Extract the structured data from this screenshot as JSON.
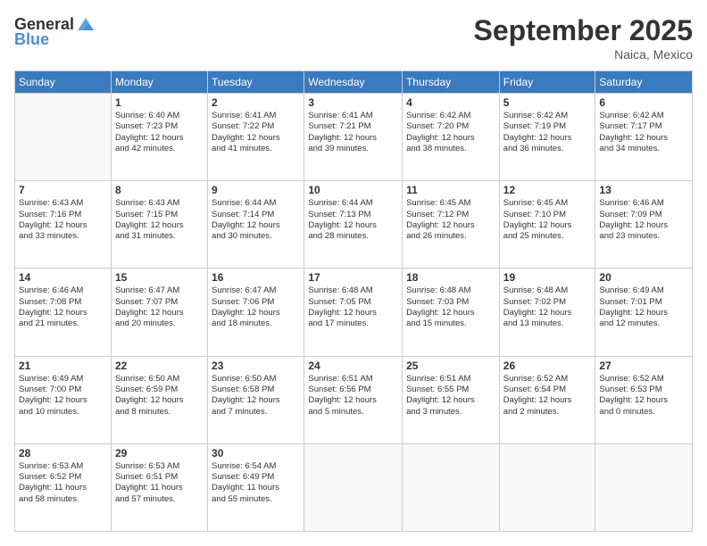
{
  "header": {
    "logo_general": "General",
    "logo_blue": "Blue",
    "month_title": "September 2025",
    "location": "Naica, Mexico"
  },
  "days_of_week": [
    "Sunday",
    "Monday",
    "Tuesday",
    "Wednesday",
    "Thursday",
    "Friday",
    "Saturday"
  ],
  "weeks": [
    [
      {
        "day": "",
        "info": ""
      },
      {
        "day": "1",
        "info": "Sunrise: 6:40 AM\nSunset: 7:23 PM\nDaylight: 12 hours\nand 42 minutes."
      },
      {
        "day": "2",
        "info": "Sunrise: 6:41 AM\nSunset: 7:22 PM\nDaylight: 12 hours\nand 41 minutes."
      },
      {
        "day": "3",
        "info": "Sunrise: 6:41 AM\nSunset: 7:21 PM\nDaylight: 12 hours\nand 39 minutes."
      },
      {
        "day": "4",
        "info": "Sunrise: 6:42 AM\nSunset: 7:20 PM\nDaylight: 12 hours\nand 38 minutes."
      },
      {
        "day": "5",
        "info": "Sunrise: 6:42 AM\nSunset: 7:19 PM\nDaylight: 12 hours\nand 36 minutes."
      },
      {
        "day": "6",
        "info": "Sunrise: 6:42 AM\nSunset: 7:17 PM\nDaylight: 12 hours\nand 34 minutes."
      }
    ],
    [
      {
        "day": "7",
        "info": "Sunrise: 6:43 AM\nSunset: 7:16 PM\nDaylight: 12 hours\nand 33 minutes."
      },
      {
        "day": "8",
        "info": "Sunrise: 6:43 AM\nSunset: 7:15 PM\nDaylight: 12 hours\nand 31 minutes."
      },
      {
        "day": "9",
        "info": "Sunrise: 6:44 AM\nSunset: 7:14 PM\nDaylight: 12 hours\nand 30 minutes."
      },
      {
        "day": "10",
        "info": "Sunrise: 6:44 AM\nSunset: 7:13 PM\nDaylight: 12 hours\nand 28 minutes."
      },
      {
        "day": "11",
        "info": "Sunrise: 6:45 AM\nSunset: 7:12 PM\nDaylight: 12 hours\nand 26 minutes."
      },
      {
        "day": "12",
        "info": "Sunrise: 6:45 AM\nSunset: 7:10 PM\nDaylight: 12 hours\nand 25 minutes."
      },
      {
        "day": "13",
        "info": "Sunrise: 6:46 AM\nSunset: 7:09 PM\nDaylight: 12 hours\nand 23 minutes."
      }
    ],
    [
      {
        "day": "14",
        "info": "Sunrise: 6:46 AM\nSunset: 7:08 PM\nDaylight: 12 hours\nand 21 minutes."
      },
      {
        "day": "15",
        "info": "Sunrise: 6:47 AM\nSunset: 7:07 PM\nDaylight: 12 hours\nand 20 minutes."
      },
      {
        "day": "16",
        "info": "Sunrise: 6:47 AM\nSunset: 7:06 PM\nDaylight: 12 hours\nand 18 minutes."
      },
      {
        "day": "17",
        "info": "Sunrise: 6:48 AM\nSunset: 7:05 PM\nDaylight: 12 hours\nand 17 minutes."
      },
      {
        "day": "18",
        "info": "Sunrise: 6:48 AM\nSunset: 7:03 PM\nDaylight: 12 hours\nand 15 minutes."
      },
      {
        "day": "19",
        "info": "Sunrise: 6:48 AM\nSunset: 7:02 PM\nDaylight: 12 hours\nand 13 minutes."
      },
      {
        "day": "20",
        "info": "Sunrise: 6:49 AM\nSunset: 7:01 PM\nDaylight: 12 hours\nand 12 minutes."
      }
    ],
    [
      {
        "day": "21",
        "info": "Sunrise: 6:49 AM\nSunset: 7:00 PM\nDaylight: 12 hours\nand 10 minutes."
      },
      {
        "day": "22",
        "info": "Sunrise: 6:50 AM\nSunset: 6:59 PM\nDaylight: 12 hours\nand 8 minutes."
      },
      {
        "day": "23",
        "info": "Sunrise: 6:50 AM\nSunset: 6:58 PM\nDaylight: 12 hours\nand 7 minutes."
      },
      {
        "day": "24",
        "info": "Sunrise: 6:51 AM\nSunset: 6:56 PM\nDaylight: 12 hours\nand 5 minutes."
      },
      {
        "day": "25",
        "info": "Sunrise: 6:51 AM\nSunset: 6:55 PM\nDaylight: 12 hours\nand 3 minutes."
      },
      {
        "day": "26",
        "info": "Sunrise: 6:52 AM\nSunset: 6:54 PM\nDaylight: 12 hours\nand 2 minutes."
      },
      {
        "day": "27",
        "info": "Sunrise: 6:52 AM\nSunset: 6:53 PM\nDaylight: 12 hours\nand 0 minutes."
      }
    ],
    [
      {
        "day": "28",
        "info": "Sunrise: 6:53 AM\nSunset: 6:52 PM\nDaylight: 11 hours\nand 58 minutes."
      },
      {
        "day": "29",
        "info": "Sunrise: 6:53 AM\nSunset: 6:51 PM\nDaylight: 11 hours\nand 57 minutes."
      },
      {
        "day": "30",
        "info": "Sunrise: 6:54 AM\nSunset: 6:49 PM\nDaylight: 11 hours\nand 55 minutes."
      },
      {
        "day": "",
        "info": ""
      },
      {
        "day": "",
        "info": ""
      },
      {
        "day": "",
        "info": ""
      },
      {
        "day": "",
        "info": ""
      }
    ]
  ]
}
